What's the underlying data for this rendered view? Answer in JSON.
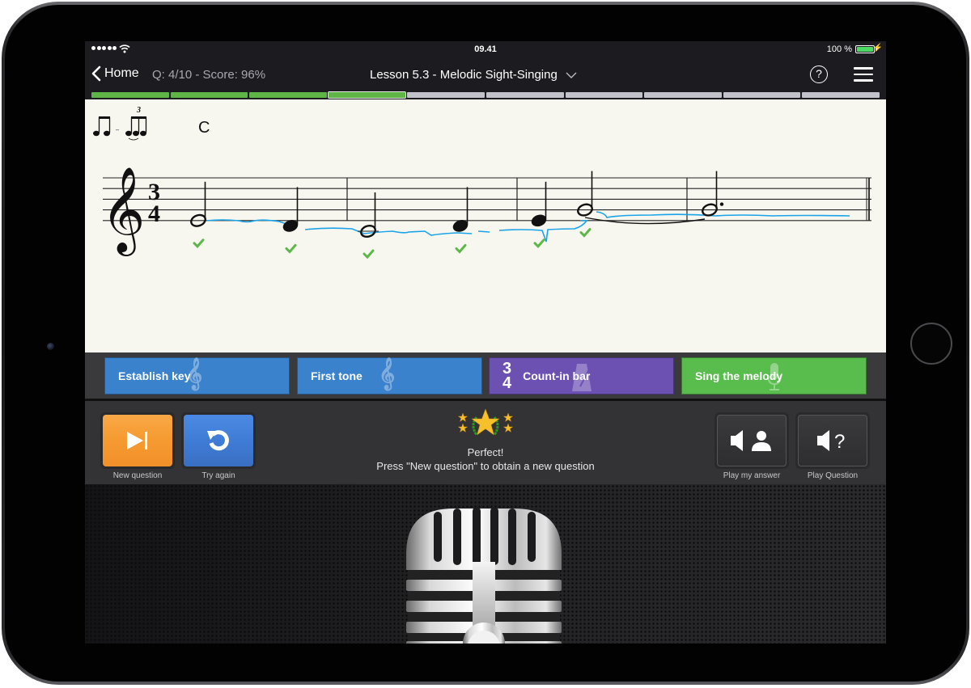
{
  "status_bar": {
    "signal_dots": 5,
    "time": "09.41",
    "battery_percent": "100 %",
    "battery_level": 1.0
  },
  "nav": {
    "back_label": "Home",
    "score_text": "Q: 4/10 - Score: 96%",
    "lesson_title": "Lesson 5.3 - Melodic Sight-Singing",
    "help_label": "?"
  },
  "progress": {
    "total": 10,
    "completed": 3,
    "current": 4
  },
  "score_sheet": {
    "rhythm_hint": "eighth-notes / triplet",
    "triplet_number": "3",
    "chord": "C",
    "clef": "treble",
    "time_signature": {
      "top": "3",
      "bottom": "4"
    },
    "notes": [
      {
        "pitch": "E4",
        "duration": "half",
        "correct": true
      },
      {
        "pitch": "D4",
        "duration": "quarter",
        "correct": true
      },
      {
        "pitch": "C4",
        "duration": "half",
        "correct": true
      },
      {
        "pitch": "D4",
        "duration": "quarter",
        "correct": true
      },
      {
        "pitch": "E4",
        "duration": "quarter",
        "correct": true
      },
      {
        "pitch": "G4",
        "duration": "half",
        "correct": true,
        "tied": true
      },
      {
        "pitch": "G4",
        "duration": "dotted-half",
        "correct": null
      }
    ],
    "colors": {
      "pitch_trace": "#1aa3e8",
      "check": "#5cb848"
    }
  },
  "steps": [
    {
      "label": "Establish key",
      "icon": "treble-clef-icon",
      "color": "#3b82cc"
    },
    {
      "label": "First tone",
      "icon": "treble-clef-icon",
      "color": "#3b82cc"
    },
    {
      "label": "Count-in bar",
      "icon": "metronome-icon",
      "ts_top": "3",
      "ts_bottom": "4",
      "color": "#6c51b2"
    },
    {
      "label": "Sing the melody",
      "icon": "microphone-icon",
      "color": "#59bd4d"
    }
  ],
  "controls": {
    "new_question": "New question",
    "try_again": "Try again",
    "play_my_answer": "Play my answer",
    "play_question": "Play Question",
    "play_question_glyph": "?"
  },
  "result": {
    "rating": "5 stars",
    "title": "Perfect!",
    "message": "Press \"New question\" to obtain a new question"
  }
}
